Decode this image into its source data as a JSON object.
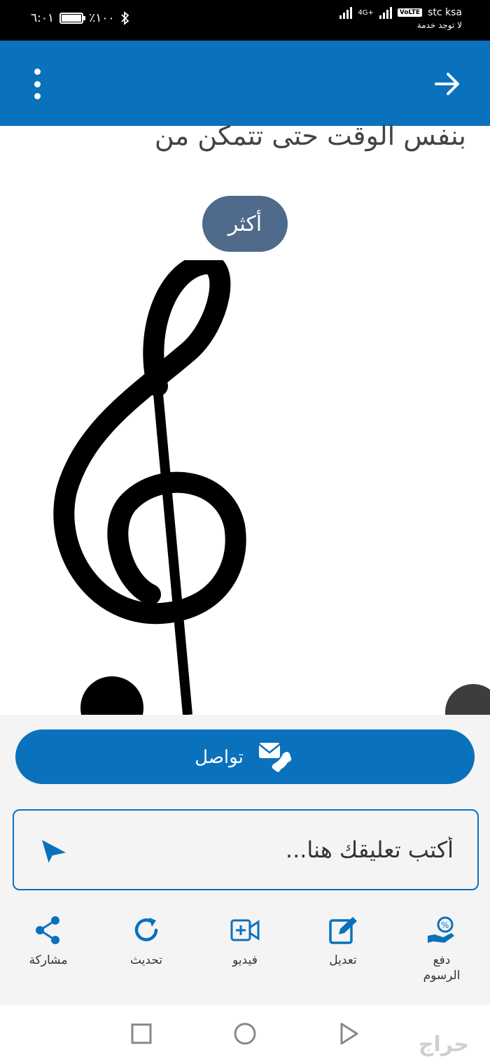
{
  "status_bar": {
    "time": "٦:٠١",
    "battery": "٪١٠٠",
    "carrier": "stc ksa",
    "network": "4G+",
    "volte": "VoLTE",
    "no_service": "لا توجد خدمة"
  },
  "content": {
    "text_line": "بنفس الوقت حتى تتمكن من",
    "more_label": "أكثر"
  },
  "contact": {
    "label": "تواصل"
  },
  "comment": {
    "placeholder": "أكتب تعليقك هنا..."
  },
  "actions": [
    {
      "label": "مشاركة",
      "icon": "share-icon"
    },
    {
      "label": "تحديث",
      "icon": "refresh-icon"
    },
    {
      "label": "فيديو",
      "icon": "video-add-icon"
    },
    {
      "label": "تعديل",
      "icon": "edit-icon"
    },
    {
      "label": "دفع الرسوم",
      "icon": "pay-fees-icon"
    }
  ],
  "watermark": "حراج",
  "colors": {
    "primary": "#0a71bd",
    "more_button": "#4f6a8a",
    "panel_bg": "#f4f4f4"
  }
}
